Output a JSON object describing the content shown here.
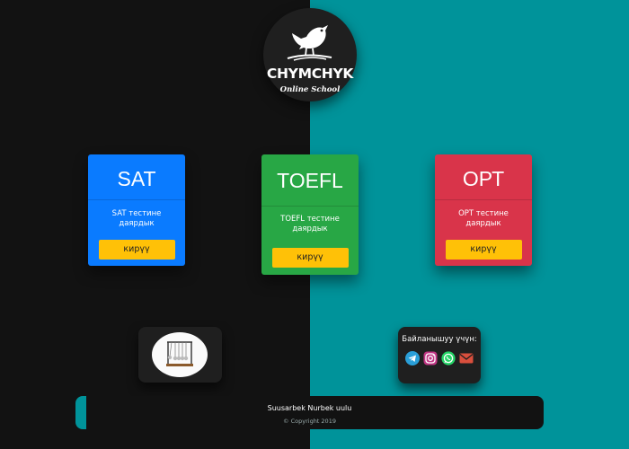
{
  "logo": {
    "brand": "CHYMCHYK",
    "subtitle": "Online School",
    "icon": "sparrow-bird-icon"
  },
  "cards": [
    {
      "title": "SAT",
      "description": "SAT тестине даярдык",
      "button_label": "кирүү",
      "color": "#0a7bff"
    },
    {
      "title": "TOEFL",
      "description": "TOEFL тестине даярдык",
      "button_label": "кирүү",
      "color": "#28a745"
    },
    {
      "title": "ОРТ",
      "description": "ОРТ тестине даярдык",
      "button_label": "кирүү",
      "color": "#d9344a"
    }
  ],
  "widget": {
    "icon": "newtons-cradle-icon"
  },
  "contacts": {
    "title": "Байланышуу үчүн:",
    "icons": [
      "telegram-icon",
      "instagram-icon",
      "whatsapp-icon",
      "email-icon"
    ]
  },
  "footer": {
    "author": "Suusarbek Nurbek uulu",
    "copyright": "© Copyright 2019"
  },
  "colors": {
    "left_background": "#121212",
    "right_background": "#00939a",
    "button": "#ffc107"
  }
}
